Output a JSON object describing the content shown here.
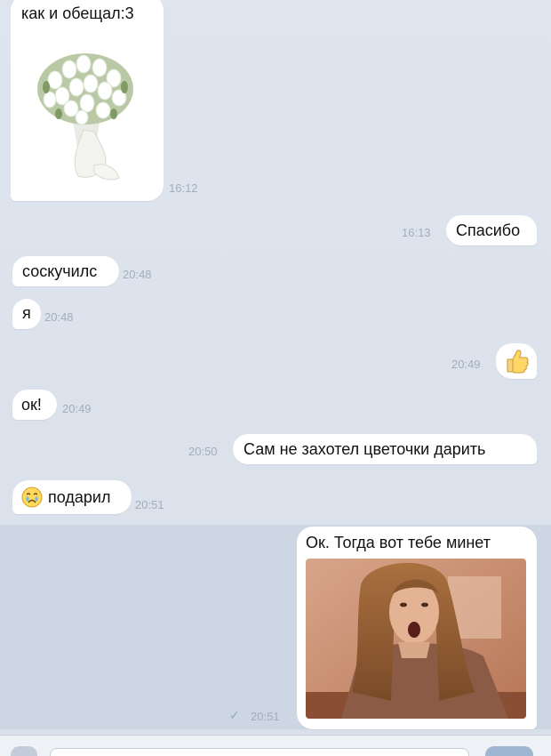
{
  "messages": [
    {
      "text": "как и обещал:3",
      "time": "16:12"
    },
    {
      "text": "Спасибо",
      "time": "16:13"
    },
    {
      "text": "соскучилс",
      "time": "20:48"
    },
    {
      "text": "я",
      "time": "20:48"
    },
    {
      "text": "",
      "time": "20:49"
    },
    {
      "text": "ок!",
      "time": "20:49"
    },
    {
      "text": "Сам не захотел цветочки дарить",
      "time": "20:50"
    },
    {
      "text": "подарил",
      "time": "20:51"
    },
    {
      "text": "Ок. Тогда вот тебе минет",
      "time": "20:51"
    }
  ],
  "icons": {
    "flower_photo": "flower-bouquet-photo",
    "thumbs_up": "thumbs-up-icon",
    "crying_emoji": "crying-face-icon",
    "read_check": "checkmark-icon"
  },
  "colors": {
    "background": "#dde3ed",
    "bubble": "#ffffff",
    "timestamp": "#a3adbb",
    "unread_band": "#cdd7e4"
  }
}
